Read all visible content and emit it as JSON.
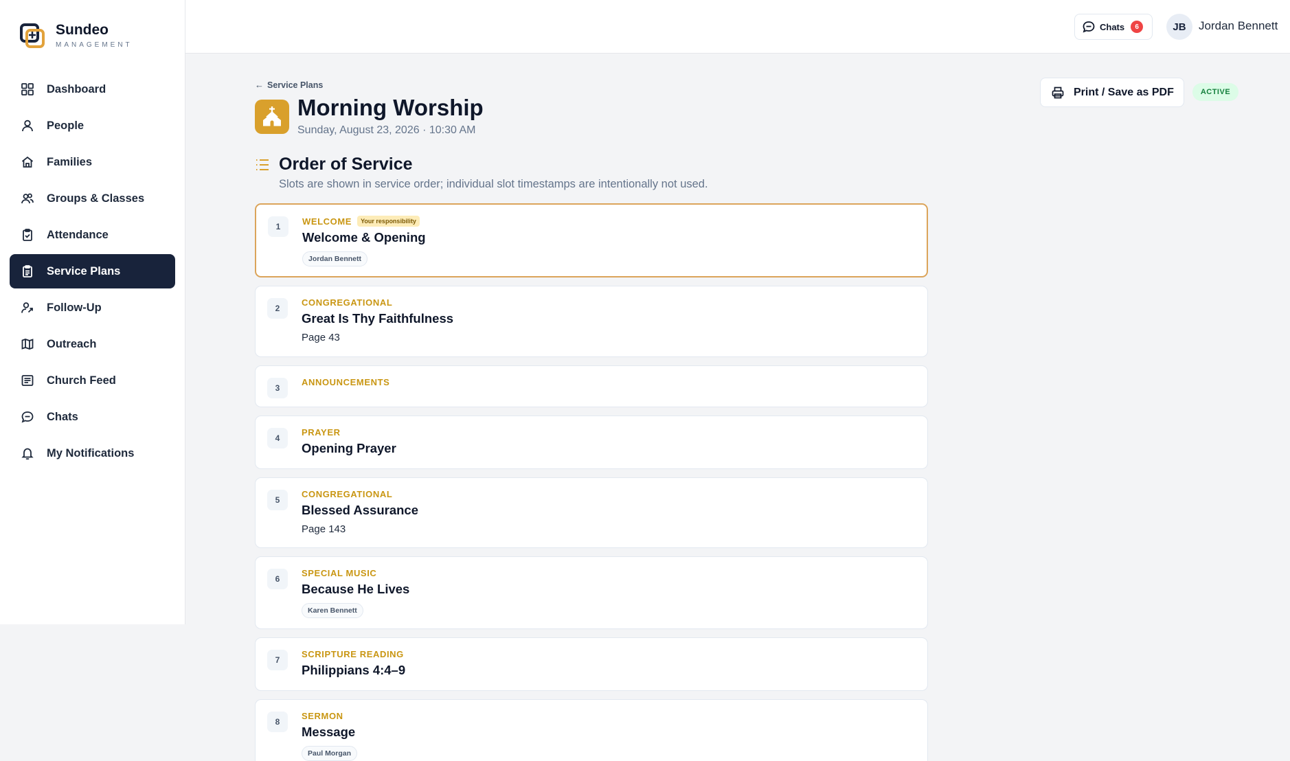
{
  "brand": {
    "name": "Sundeo",
    "subtitle": "MANAGEMENT"
  },
  "sidebar": {
    "items": [
      {
        "label": "Dashboard",
        "icon": "dashboard-icon"
      },
      {
        "label": "People",
        "icon": "person-icon"
      },
      {
        "label": "Families",
        "icon": "home-icon"
      },
      {
        "label": "Groups & Classes",
        "icon": "users-icon"
      },
      {
        "label": "Attendance",
        "icon": "clipboard-check-icon"
      },
      {
        "label": "Service Plans",
        "icon": "clipboard-list-icon",
        "active": true
      },
      {
        "label": "Follow-Up",
        "icon": "user-follow-icon"
      },
      {
        "label": "Outreach",
        "icon": "map-icon"
      },
      {
        "label": "Church Feed",
        "icon": "feed-icon"
      },
      {
        "label": "Chats",
        "icon": "chat-icon"
      },
      {
        "label": "My Notifications",
        "icon": "bell-icon"
      }
    ]
  },
  "topbar": {
    "chats_label": "Chats",
    "chats_count": "6",
    "user_initials": "JB",
    "user_name": "Jordan Bennett"
  },
  "header": {
    "back_label": "Service Plans",
    "title": "Morning Worship",
    "date": "Sunday, August 23, 2026 · 10:30 AM",
    "print_label": "Print / Save as PDF",
    "status": "ACTIVE"
  },
  "section": {
    "title": "Order of Service",
    "description": "Slots are shown in service order; individual slot timestamps are intentionally not used."
  },
  "slots": [
    {
      "num": "1",
      "type": "WELCOME",
      "badge": "Your responsibility",
      "title": "Welcome & Opening",
      "note": "",
      "person": "Jordan Bennett",
      "highlight": true
    },
    {
      "num": "2",
      "type": "CONGREGATIONAL",
      "badge": "",
      "title": "Great Is Thy Faithfulness",
      "note": "Page 43",
      "person": ""
    },
    {
      "num": "3",
      "type": "ANNOUNCEMENTS",
      "badge": "",
      "title": "",
      "note": "",
      "person": ""
    },
    {
      "num": "4",
      "type": "PRAYER",
      "badge": "",
      "title": "Opening Prayer",
      "note": "",
      "person": ""
    },
    {
      "num": "5",
      "type": "CONGREGATIONAL",
      "badge": "",
      "title": "Blessed Assurance",
      "note": "Page 143",
      "person": ""
    },
    {
      "num": "6",
      "type": "SPECIAL MUSIC",
      "badge": "",
      "title": "Because He Lives",
      "note": "",
      "person": "Karen Bennett"
    },
    {
      "num": "7",
      "type": "SCRIPTURE READING",
      "badge": "",
      "title": "Philippians 4:4–9",
      "note": "",
      "person": ""
    },
    {
      "num": "8",
      "type": "SERMON",
      "badge": "",
      "title": "Message",
      "note": "",
      "person": "Paul Morgan"
    }
  ],
  "colors": {
    "accent": "#c99612",
    "nav_active": "#18233b",
    "badge_red": "#ef4444",
    "status_green": "#15803d"
  }
}
